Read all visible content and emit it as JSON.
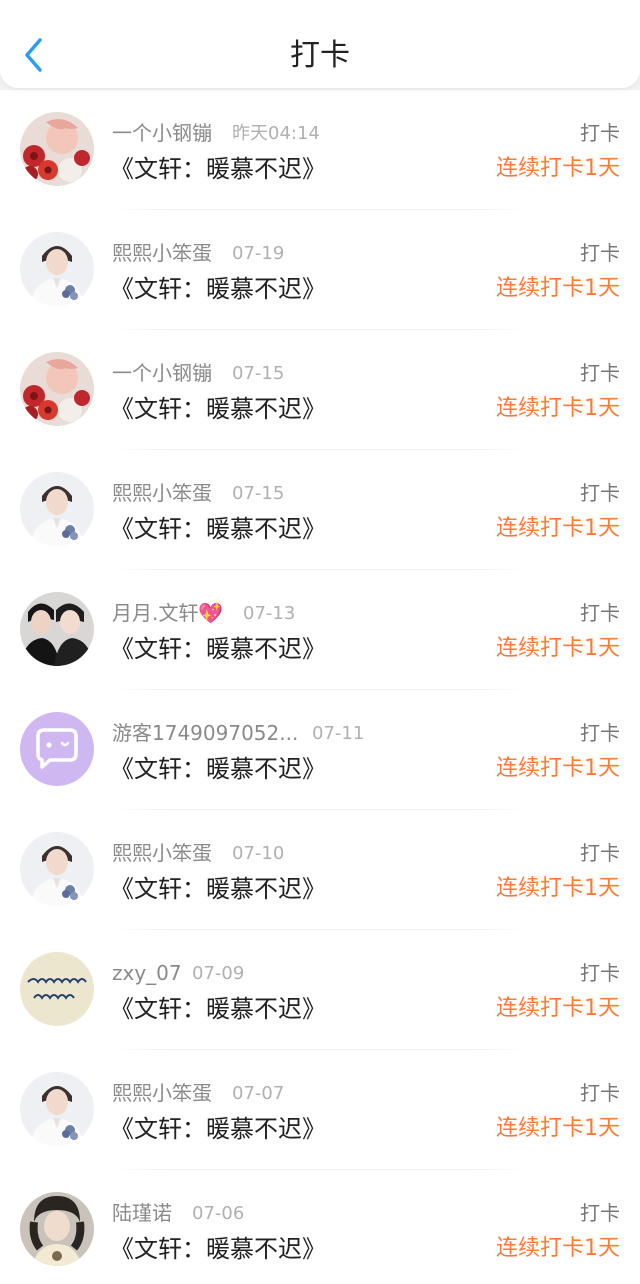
{
  "header": {
    "title": "打卡",
    "back_icon": "chevron-left-icon",
    "accent": "#2d9cf0"
  },
  "colors": {
    "streak": "#ff7a32",
    "name": "#8a8a8a",
    "time": "#b0b0b0"
  },
  "items": [
    {
      "user": "一个小钢镚",
      "time": "昨天04:14",
      "book": "《文轩：暖慕不迟》",
      "action": "打卡",
      "streak": "连续打卡1天",
      "avatar": "avatar-red-flowers"
    },
    {
      "user": "熙熙小笨蛋",
      "time": "07-19",
      "book": "《文轩：暖慕不迟》",
      "action": "打卡",
      "streak": "连续打卡1天",
      "avatar": "avatar-white-suit"
    },
    {
      "user": "一个小钢镚",
      "time": "07-15",
      "book": "《文轩：暖慕不迟》",
      "action": "打卡",
      "streak": "连续打卡1天",
      "avatar": "avatar-red-flowers"
    },
    {
      "user": "熙熙小笨蛋",
      "time": "07-15",
      "book": "《文轩：暖慕不迟》",
      "action": "打卡",
      "streak": "连续打卡1天",
      "avatar": "avatar-white-suit"
    },
    {
      "user": "月月.文轩💖",
      "time": "07-13",
      "book": "《文轩：暖慕不迟》",
      "action": "打卡",
      "streak": "连续打卡1天",
      "avatar": "avatar-two-people"
    },
    {
      "user": "游客1749097052...",
      "time": "07-11",
      "book": "《文轩：暖慕不迟》",
      "action": "打卡",
      "streak": "连续打卡1天",
      "avatar": "avatar-purple-chat"
    },
    {
      "user": "熙熙小笨蛋",
      "time": "07-10",
      "book": "《文轩：暖慕不迟》",
      "action": "打卡",
      "streak": "连续打卡1天",
      "avatar": "avatar-white-suit"
    },
    {
      "user": "zxy_07",
      "time": "07-09",
      "book": "《文轩：暖慕不迟》",
      "action": "打卡",
      "streak": "连续打卡1天",
      "avatar": "avatar-handwriting"
    },
    {
      "user": "熙熙小笨蛋",
      "time": "07-07",
      "book": "《文轩：暖慕不迟》",
      "action": "打卡",
      "streak": "连续打卡1天",
      "avatar": "avatar-white-suit"
    },
    {
      "user": "陆瑾诺",
      "time": "07-06",
      "book": "《文轩：暖慕不迟》",
      "action": "打卡",
      "streak": "连续打卡1天",
      "avatar": "avatar-portrait"
    }
  ]
}
